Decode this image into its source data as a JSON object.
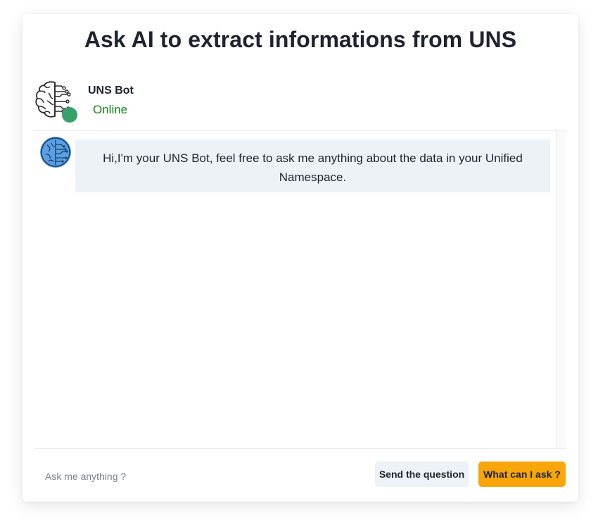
{
  "page": {
    "title": "Ask AI to extract informations from UNS"
  },
  "bot": {
    "name": "UNS Bot",
    "status": "Online",
    "status_color": "#38a169",
    "avatar_icon": "brain-circuit-icon"
  },
  "messages": [
    {
      "sender": "bot",
      "avatar_icon": "blue-brain-icon",
      "text": "Hi,I'm your UNS Bot, feel free to ask me anything about the data in your Unified Namespace."
    }
  ],
  "input": {
    "placeholder": "Ask me anything ?",
    "value": ""
  },
  "buttons": {
    "send_label": "Send the question",
    "help_label": "What can I ask ?"
  },
  "colors": {
    "accent": "#f8a60a",
    "bubble_bg": "#edf2f7",
    "online_text": "#138a13"
  }
}
